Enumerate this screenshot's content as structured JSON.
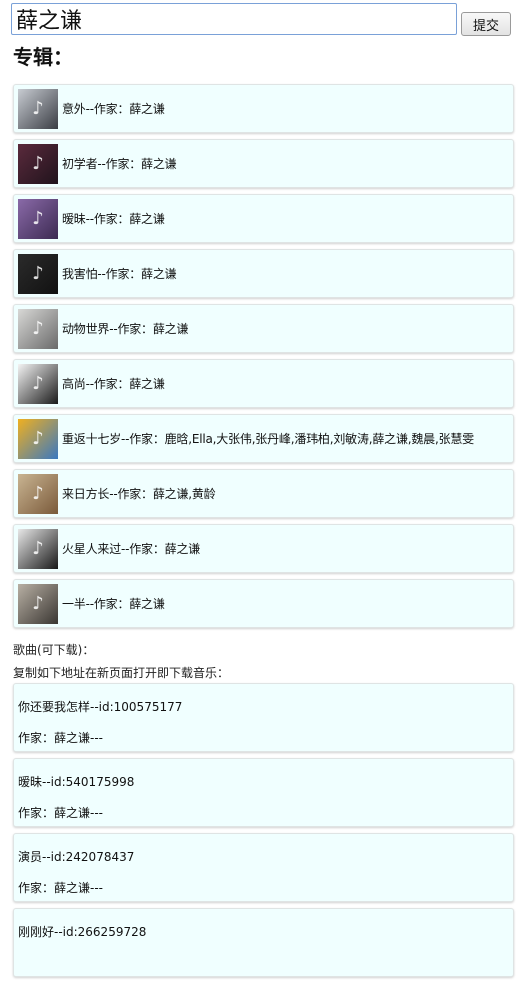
{
  "search": {
    "value": "薛之谦",
    "submit_label": "提交"
  },
  "albums_heading": "专辑：",
  "albums": [
    {
      "text": "意外--作家：薛之谦",
      "cover_icon": "person-photo",
      "cover_colors": [
        "#c8ccd2",
        "#3a3d44"
      ]
    },
    {
      "text": "初学者--作家：薛之谦",
      "cover_icon": "person-photo",
      "cover_colors": [
        "#5a2a3c",
        "#20131c"
      ]
    },
    {
      "text": "暧昧--作家：薛之谦",
      "cover_icon": "person-photo",
      "cover_colors": [
        "#8a6aa8",
        "#3c2a52"
      ]
    },
    {
      "text": "我害怕--作家：薛之谦",
      "cover_icon": "dark-photo",
      "cover_colors": [
        "#2b2b2b",
        "#111111"
      ]
    },
    {
      "text": "动物世界--作家：薛之谦",
      "cover_icon": "zebra-photo",
      "cover_colors": [
        "#d8d8d6",
        "#6a6a6a"
      ]
    },
    {
      "text": "高尚--作家：薛之谦",
      "cover_icon": "figure-photo",
      "cover_colors": [
        "#f4f4f4",
        "#1a1a1a"
      ]
    },
    {
      "text": "重返十七岁--作家：鹿晗,Ella,大张伟,张丹峰,潘玮柏,刘敏涛,薛之谦,魏晨,张慧雯",
      "cover_icon": "group-photo",
      "cover_colors": [
        "#f0b020",
        "#3a78c0"
      ]
    },
    {
      "text": "来日方长--作家：薛之谦,黄龄",
      "cover_icon": "poster-photo",
      "cover_colors": [
        "#c9b492",
        "#7a5a3a"
      ]
    },
    {
      "text": "火星人来过--作家：薛之谦",
      "cover_icon": "circle-photo",
      "cover_colors": [
        "#e8e8e8",
        "#181818"
      ]
    },
    {
      "text": "一半--作家：薛之谦",
      "cover_icon": "room-photo",
      "cover_colors": [
        "#b8b0a4",
        "#3a3632"
      ]
    }
  ],
  "songs_heading": "歌曲(可下载)：",
  "songs_instruction": "复制如下地址在新页面打开即下载音乐：",
  "songs": [
    {
      "title": "你还要我怎样--id:100575177",
      "artist": "作家：薛之谦---"
    },
    {
      "title": "暧昧--id:540175998",
      "artist": "作家：薛之谦---"
    },
    {
      "title": "演员--id:242078437",
      "artist": "作家：薛之谦---"
    },
    {
      "title": "刚刚好--id:266259728",
      "artist": ""
    }
  ],
  "colors": {
    "card_background": "#f0ffff",
    "input_border": "#7aa1d8"
  }
}
